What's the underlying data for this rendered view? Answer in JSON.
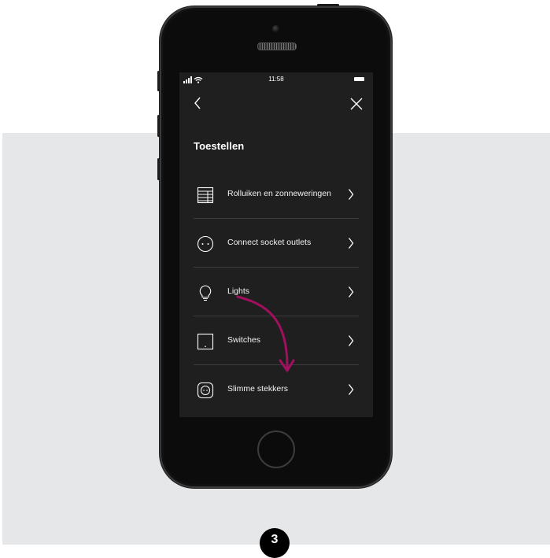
{
  "status_bar": {
    "time": "11:58"
  },
  "screen": {
    "title": "Toestellen"
  },
  "menu": {
    "items": [
      {
        "label": "Rolluiken en zonneweringen",
        "icon": "shutter-icon"
      },
      {
        "label": "Connect socket outlets",
        "icon": "socket-outlet-icon"
      },
      {
        "label": "Lights",
        "icon": "light-bulb-icon"
      },
      {
        "label": "Switches",
        "icon": "switch-icon"
      },
      {
        "label": "Slimme stekkers",
        "icon": "smart-plug-icon"
      }
    ]
  },
  "step_badge": "3",
  "colors": {
    "accent_arrow": "#a0105f",
    "screen_bg": "#1f1f1f",
    "backdrop": "#e6e7e8"
  }
}
